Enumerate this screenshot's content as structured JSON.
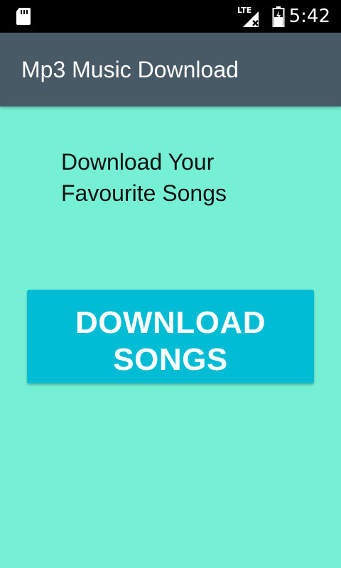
{
  "status_bar": {
    "network_label": "LTE",
    "time": "5:42"
  },
  "icons": {
    "sd_card": "sd-card-icon",
    "signal": "signal-icon",
    "battery": "battery-icon"
  },
  "app_bar": {
    "title": "Mp3 Music Download"
  },
  "main": {
    "headline_lines": [
      "Download Your",
      "Favourite Songs"
    ],
    "button_lines": [
      "DOWNLOAD",
      "SONGS"
    ]
  },
  "colors": {
    "background": "#75f0d5",
    "app_bar": "#475a65",
    "button": "#00bcd4",
    "status_bar": "#000000"
  }
}
